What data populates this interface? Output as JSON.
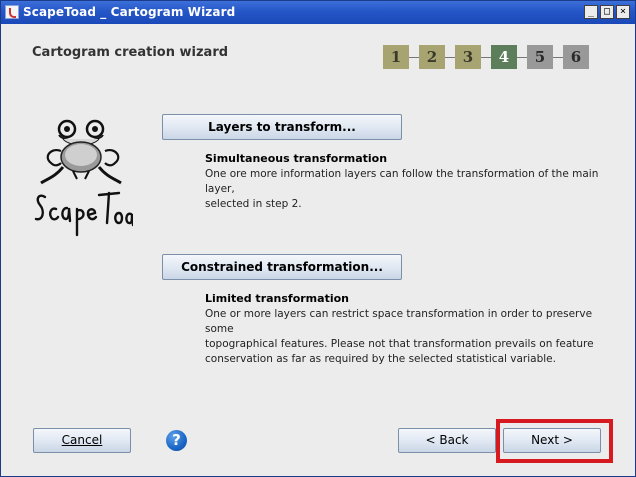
{
  "window": {
    "title": "ScapeToad _ Cartogram Wizard",
    "controls": {
      "minimize": "_",
      "maximize": "□",
      "close": "×"
    }
  },
  "wizard": {
    "title": "Cartogram creation wizard",
    "steps": [
      "1",
      "2",
      "3",
      "4",
      "5",
      "6"
    ],
    "current_step": 4,
    "step_colors": {
      "done": "#a8a472",
      "current": "#5d7e5a",
      "todo": "#999999"
    }
  },
  "logo": {
    "name": "ScapeToad",
    "letters": [
      "S",
      "c",
      "a",
      "p",
      "e",
      "T",
      "o",
      "a",
      "d"
    ]
  },
  "sections": [
    {
      "button_label": "Layers to transform...",
      "heading": "Simultaneous transformation",
      "lines": [
        "One ore more information layers can follow the transformation of the main layer,",
        "selected in step 2."
      ]
    },
    {
      "button_label": "Constrained transformation...",
      "heading": "Limited transformation",
      "lines": [
        "One or more layers can restrict space transformation in order to preserve some",
        "topographical features. Please not that transformation prevails on feature",
        "conservation as far as required by the selected statistical variable."
      ]
    }
  ],
  "footer": {
    "cancel_label": "Cancel",
    "help_icon": "question-mark-icon",
    "help_glyph": "?",
    "back_label": "< Back",
    "next_label": "Next >"
  },
  "annotation": {
    "highlight_color": "#d71920",
    "highlight_target": "next-button"
  }
}
